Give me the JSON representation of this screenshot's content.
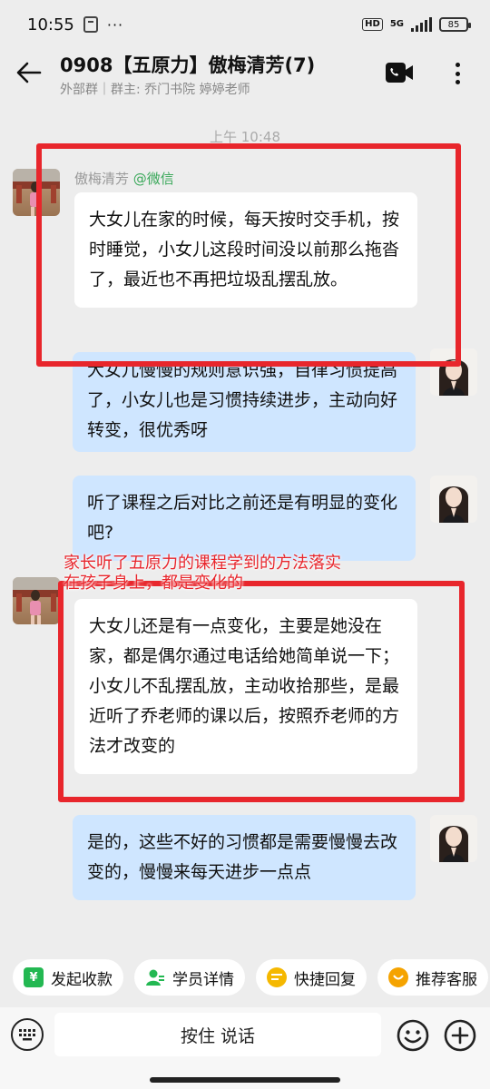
{
  "status_bar": {
    "time": "10:55",
    "more": "···",
    "hd": "HD",
    "network": "5G",
    "battery": "85"
  },
  "header": {
    "title": "0908【五原力】傲梅清芳(7)",
    "subtitle": "外部群｜群主: 乔门书院 婷婷老师"
  },
  "chat": {
    "timestamp": "上午 10:48",
    "messages": [
      {
        "sender": "傲梅清芳",
        "sender_tag": "@微信",
        "text": "大女儿在家的时候，每天按时交手机，按时睡觉，小女儿这段时间没以前那么拖沓了，最近也不再把垃圾乱摆乱放。"
      },
      {
        "text": "大女儿慢慢的规则意识强，自律习惯提高了，小女儿也是习惯持续进步，主动向好转变，很优秀呀"
      },
      {
        "text": "听了课程之后对比之前还是有明显的变化吧?"
      },
      {
        "text": "大女儿还是有一点变化，主要是她没在家，都是偶尔通过电话给她简单说一下；小女儿不乱摆乱放，主动收拾那些，是最近听了乔老师的课以后，按照乔老师的方法才改变的"
      },
      {
        "text": "是的，这些不好的习惯都是需要慢慢去改变的，慢慢来每天进步一点点"
      }
    ],
    "annotation": "家长听了五原力的课程学到的方法落实\n在孩子身上，都是变化的"
  },
  "quick_actions": [
    {
      "label": "发起收款",
      "icon": "yen-icon",
      "color": "#23b852"
    },
    {
      "label": "学员详情",
      "icon": "user-icon",
      "color": "#23b852"
    },
    {
      "label": "快捷回复",
      "icon": "reply-icon",
      "color": "#f5b800"
    },
    {
      "label": "推荐客服",
      "icon": "service-icon",
      "color": "#f5a300"
    }
  ],
  "input_bar": {
    "voice_label": "按住 说话"
  }
}
